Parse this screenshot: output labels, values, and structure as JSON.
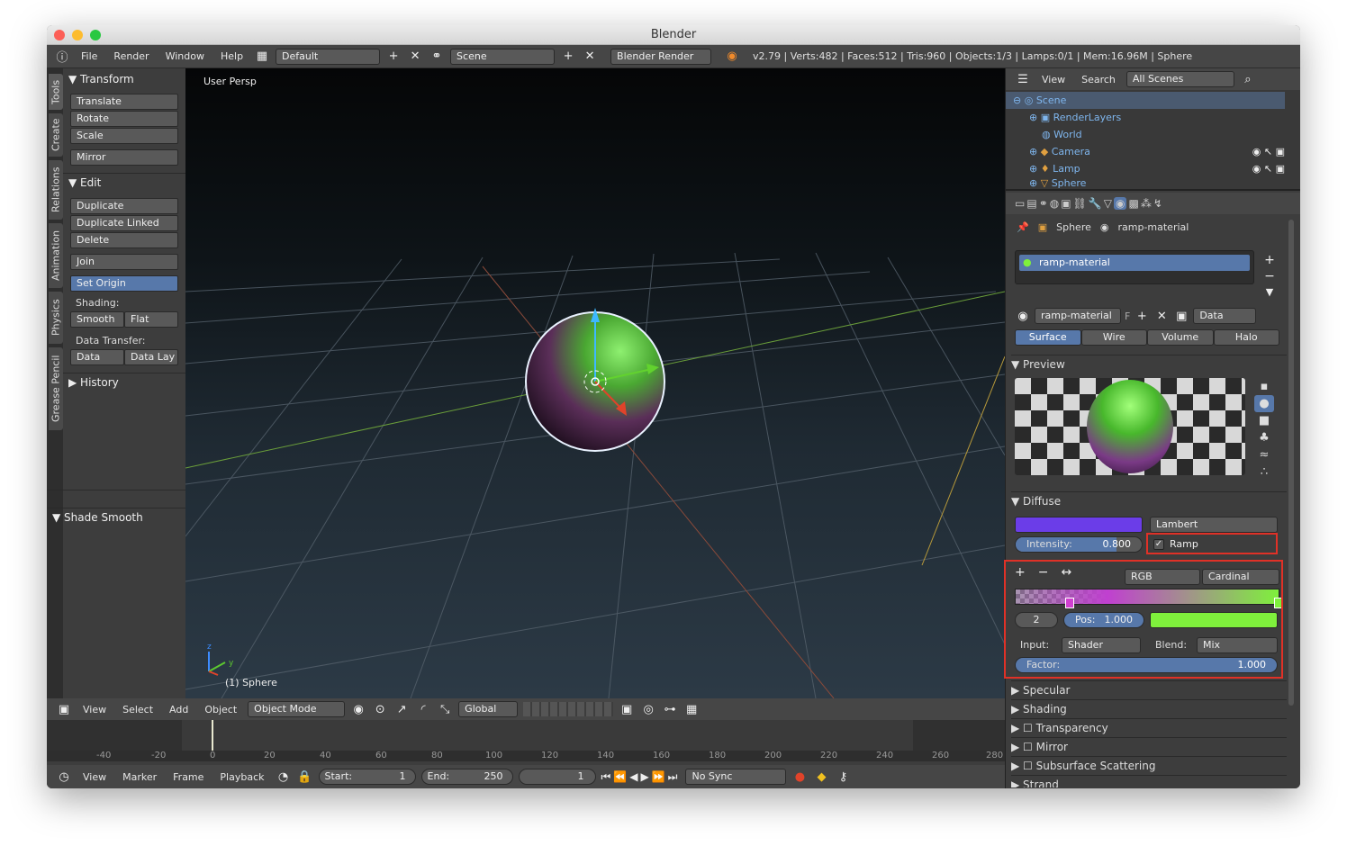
{
  "window": {
    "title": "Blender"
  },
  "topbar": {
    "menus": [
      "File",
      "Render",
      "Window",
      "Help"
    ],
    "layout": "Default",
    "scene": "Scene",
    "engine": "Blender Render",
    "stats": "v2.79 | Verts:482 | Faces:512 | Tris:960 | Objects:1/3 | Lamps:0/1 | Mem:16.96M | Sphere"
  },
  "tool_tabs": [
    "Tools",
    "Create",
    "Relations",
    "Animation",
    "Physics",
    "Grease Pencil"
  ],
  "tools": {
    "transform_header": "Transform",
    "translate": "Translate",
    "rotate": "Rotate",
    "scale": "Scale",
    "mirror": "Mirror",
    "edit_header": "Edit",
    "duplicate": "Duplicate",
    "duplicate_linked": "Duplicate Linked",
    "delete": "Delete",
    "join": "Join",
    "set_origin": "Set Origin",
    "shading_label": "Shading:",
    "smooth": "Smooth",
    "flat": "Flat",
    "data_transfer_label": "Data Transfer:",
    "data": "Data",
    "data_lay": "Data Lay",
    "history_header": "History",
    "shade_smooth_header": "Shade Smooth"
  },
  "viewport": {
    "persp_label": "User Persp",
    "object_label": "(1) Sphere",
    "axis_z": "z",
    "axis_y": "y"
  },
  "viewport_header": {
    "view": "View",
    "select": "Select",
    "add": "Add",
    "object": "Object",
    "mode": "Object Mode",
    "orientation": "Global"
  },
  "timeline": {
    "ticks": [
      "-40",
      "-20",
      "0",
      "20",
      "40",
      "60",
      "80",
      "100",
      "120",
      "140",
      "160",
      "180",
      "200",
      "220",
      "240",
      "260",
      "280"
    ],
    "view": "View",
    "marker": "Marker",
    "frame": "Frame",
    "playback": "Playback",
    "start_label": "Start:",
    "start_value": "1",
    "end_label": "End:",
    "end_value": "250",
    "current": "1",
    "sync": "No Sync"
  },
  "outliner": {
    "view": "View",
    "search": "Search",
    "filter": "All Scenes",
    "items": [
      {
        "label": "Scene",
        "icon": "scene-icon"
      },
      {
        "label": "RenderLayers",
        "icon": "renderlayers-icon"
      },
      {
        "label": "World",
        "icon": "world-icon"
      },
      {
        "label": "Camera",
        "icon": "camera-icon"
      },
      {
        "label": "Lamp",
        "icon": "lamp-icon"
      },
      {
        "label": "Sphere",
        "icon": "mesh-icon"
      }
    ]
  },
  "properties": {
    "breadcrumb_object": "Sphere",
    "breadcrumb_material": "ramp-material",
    "slot_material": "ramp-material",
    "material_name": "ramp-material",
    "material_fake": "F",
    "link": "Data",
    "tabs": [
      "Surface",
      "Wire",
      "Volume",
      "Halo"
    ],
    "preview_header": "Preview",
    "diffuse_header": "Diffuse",
    "diffuse_color": "#6b3de8",
    "diffuse_shader": "Lambert",
    "intensity_label": "Intensity:",
    "intensity_value": "0.800",
    "intensity_fraction": 0.8,
    "ramp_label": "Ramp",
    "ramp_color_mode": "RGB",
    "ramp_interp": "Cardinal",
    "ramp_index": "2",
    "ramp_pos_label": "Pos:",
    "ramp_pos_value": "1.000",
    "ramp_stop_color": "#7ff03c",
    "input_label": "Input:",
    "input_value": "Shader",
    "blend_label": "Blend:",
    "blend_value": "Mix",
    "factor_label": "Factor:",
    "factor_value": "1.000",
    "sections": [
      "Specular",
      "Shading",
      "Transparency",
      "Mirror",
      "Subsurface Scattering",
      "Strand"
    ]
  }
}
